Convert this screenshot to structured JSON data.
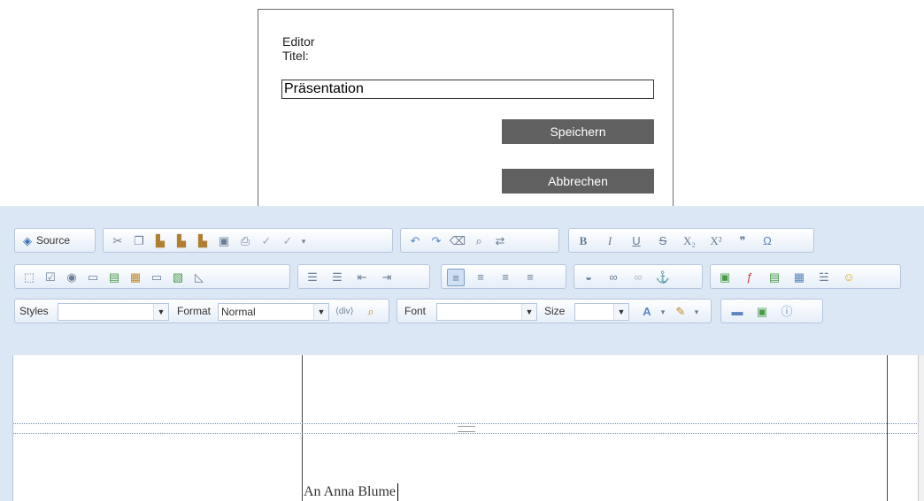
{
  "dialog": {
    "editor_label": "Editor",
    "titel_label": "Titel:",
    "titel_value": "Präsentation",
    "save_label": "Speichern",
    "cancel_label": "Abbrechen"
  },
  "toolbar": {
    "source_label": "Source",
    "styles_label": "Styles",
    "styles_value": "",
    "format_label": "Format",
    "format_value": "Normal",
    "font_label": "Font",
    "font_value": "",
    "size_label": "Size",
    "size_value": "",
    "bold": "B",
    "italic": "I",
    "underline": "U",
    "strike": "S",
    "subscript": "X₂",
    "superscript": "X²",
    "blockquote": "❞",
    "special_char": "Ω"
  },
  "content": {
    "text": "An Anna Blume"
  }
}
